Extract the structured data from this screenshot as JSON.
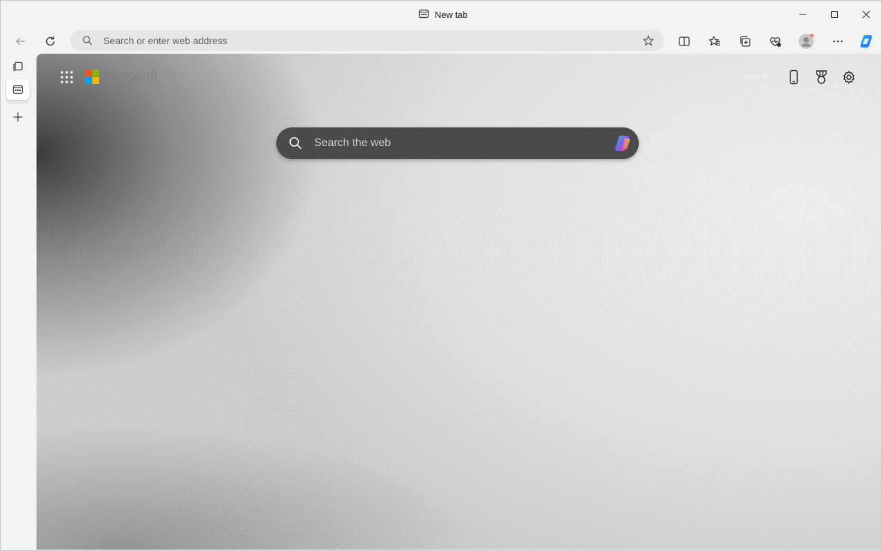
{
  "window": {
    "tab_title": "New tab"
  },
  "toolbar": {
    "address_placeholder": "Search or enter web address"
  },
  "newtab": {
    "brand": "Microsoft",
    "sign_in": "Sign in",
    "search_placeholder": "Search the web"
  },
  "icons": {
    "tab": "new-tab-page-icon",
    "back": "back-arrow-icon",
    "refresh": "refresh-icon",
    "search": "search-icon",
    "favorite": "star-icon",
    "split": "split-screen-icon",
    "favorites": "favorites-icon",
    "collections": "collections-icon",
    "performance": "browser-essentials-icon",
    "profile": "profile-avatar-icon",
    "more": "more-icon",
    "copilot": "copilot-icon",
    "apps": "app-launcher-icon",
    "phone": "mobile-icon",
    "rewards": "rewards-icon",
    "settings": "gear-icon"
  },
  "colors": {
    "ms_red": "#f25022",
    "ms_green": "#7fba00",
    "ms_blue": "#00a4ef",
    "ms_yellow": "#ffb900",
    "searchbox_bg": "#484848"
  }
}
